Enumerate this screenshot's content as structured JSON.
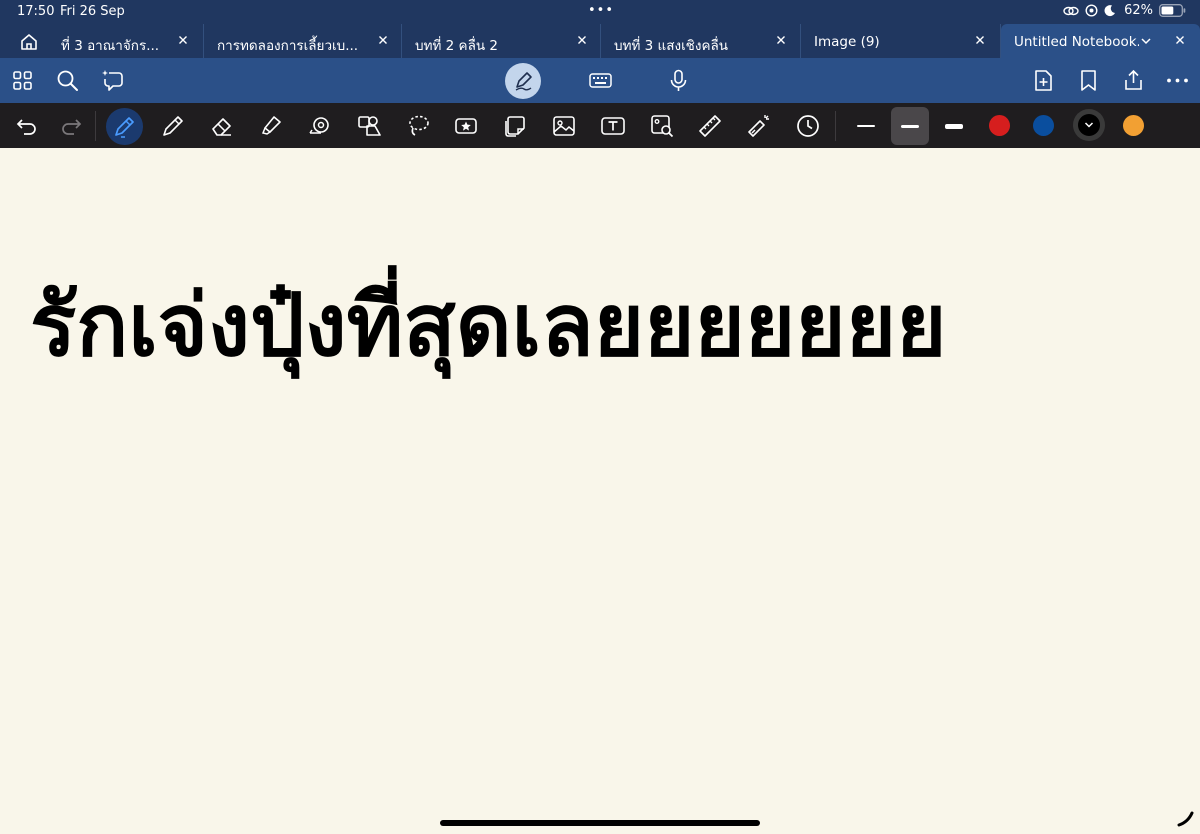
{
  "status": {
    "time": "17:50",
    "date": "Fri 26 Sep",
    "dots": "•••",
    "battery": "62%",
    "battery_level": 0.62,
    "icons": [
      "link-icon",
      "focus-icon",
      "moon-icon",
      "battery-icon"
    ]
  },
  "tabs": [
    {
      "label": "ที่ 3 อาณาจักร...",
      "active": false
    },
    {
      "label": "การทดลองการเลี้ยวเบ...",
      "active": false
    },
    {
      "label": "บทที่ 2 คลื่น 2",
      "active": false
    },
    {
      "label": "บทที่ 3 แสงเชิงคลื่น",
      "active": false
    },
    {
      "label": "Image (9)",
      "active": false
    },
    {
      "label": "Untitled Notebook...",
      "active": true
    }
  ],
  "toolbar": {
    "left_icons": [
      "grid-icon",
      "search-icon",
      "ai-assist-icon"
    ],
    "modes": [
      "pen-mode-icon",
      "keyboard-icon",
      "microphone-icon"
    ],
    "right_icons": [
      "add-page-icon",
      "bookmark-icon",
      "share-icon",
      "more-icon"
    ]
  },
  "drawing_tools": {
    "tools": [
      "undo-icon",
      "redo-icon",
      "pen-tool-icon",
      "pencil-tool-icon",
      "eraser-tool-icon",
      "highlighter-tool-icon",
      "tape-tool-icon",
      "shape-tool-icon",
      "lasso-tool-icon",
      "sticker-tool-icon",
      "sticky-note-icon",
      "image-tool-icon",
      "text-tool-icon",
      "image-search-icon",
      "ruler-icon",
      "laser-pointer-icon",
      "history-icon"
    ],
    "stroke_widths": [
      "thin",
      "medium",
      "thick"
    ],
    "selected_stroke": "medium",
    "colors": [
      "#d61e1e",
      "#0a4e9e",
      "#000000",
      "#f2a033"
    ],
    "selected_color": "#000000",
    "accent": "#2b5088",
    "bar_color": "#203760"
  },
  "canvas": {
    "text": "รักเจ่งปุ๋งที่สุดเลยยยยยยย",
    "background": "#f9f6ea"
  }
}
